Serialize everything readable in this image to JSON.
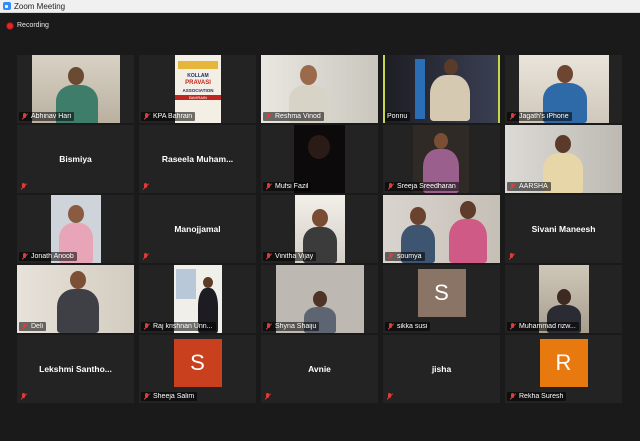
{
  "window": {
    "title": "Zoom Meeting"
  },
  "recording": {
    "label": "Recording"
  },
  "participants": [
    {
      "name": "Abhinav Hari",
      "muted": true
    },
    {
      "name": "KPA Bahrain",
      "muted": true,
      "image_text": [
        "KOLLAM",
        "PRAVASI",
        "ASSOCIATION",
        "BAHRAIN"
      ]
    },
    {
      "name": "Reshma Vinod",
      "muted": true
    },
    {
      "name": "Ponnu",
      "muted": false,
      "active_speaker": true
    },
    {
      "name": "Jagath's iPhone",
      "muted": true
    },
    {
      "name": "Bismiya",
      "muted": true,
      "video": false
    },
    {
      "name": "Raseela  Muham...",
      "muted": true,
      "video": false
    },
    {
      "name": "Mufsi Fazil",
      "muted": true
    },
    {
      "name": "Sreeja Sreedharan",
      "muted": true
    },
    {
      "name": "AARSHA",
      "muted": true
    },
    {
      "name": "Jonath Anoob",
      "muted": true
    },
    {
      "name": "Manojjamal",
      "muted": true,
      "video": false
    },
    {
      "name": "Vinitha Vijay",
      "muted": true
    },
    {
      "name": "soumya",
      "muted": true
    },
    {
      "name": "Sivani Maneesh",
      "muted": true,
      "video": false
    },
    {
      "name": "Deli",
      "muted": true
    },
    {
      "name": "Raj krishnan Unn...",
      "muted": true
    },
    {
      "name": "Shyna Shaiju",
      "muted": true
    },
    {
      "name": "sikka susi",
      "muted": true,
      "avatar_letter": "S",
      "avatar_color": "#8a7466"
    },
    {
      "name": "Muhammad rizw...",
      "muted": true
    },
    {
      "name": "Lekshmi  Santho...",
      "muted": true,
      "video": false
    },
    {
      "name": "Sheeja Salim",
      "muted": true,
      "avatar_letter": "S",
      "avatar_color": "#c8401e"
    },
    {
      "name": "Avnie",
      "muted": true,
      "video": false
    },
    {
      "name": "jisha",
      "muted": true,
      "video": false
    },
    {
      "name": "Rekha Suresh",
      "muted": true,
      "avatar_letter": "R",
      "avatar_color": "#e8790e"
    }
  ]
}
